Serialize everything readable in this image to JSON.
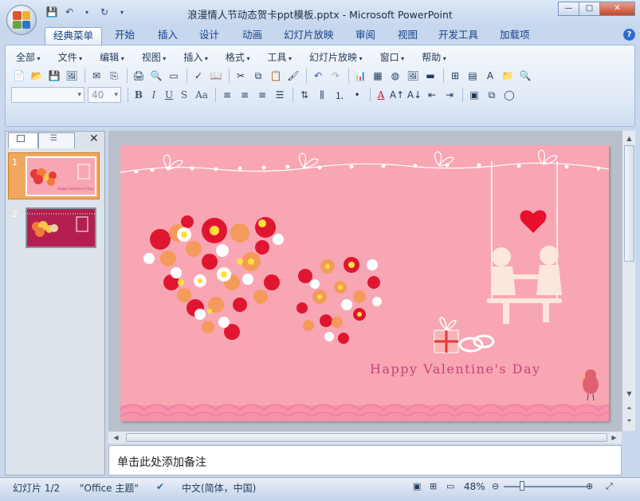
{
  "window": {
    "title": "浪漫情人节动态贺卡ppt模板.pptx - Microsoft PowerPoint",
    "minimize": "—",
    "restore": "□",
    "close": "✕"
  },
  "tabs": [
    "经典菜单",
    "开始",
    "插入",
    "设计",
    "动画",
    "幻灯片放映",
    "审阅",
    "视图",
    "开发工具",
    "加载项"
  ],
  "active_tab": "经典菜单",
  "menus": [
    "全部",
    "文件",
    "编辑",
    "视图",
    "插入",
    "格式",
    "工具",
    "幻灯片放映",
    "窗口",
    "帮助"
  ],
  "format": {
    "font_name": "",
    "font_size": "40",
    "bold": "B",
    "italic": "I",
    "underline": "U",
    "shadow": "S",
    "case": "Aa",
    "font_color": "A"
  },
  "slides": {
    "numbers": [
      "1",
      "2"
    ],
    "close": "✕"
  },
  "slide": {
    "text": "Happy Valentine's Day"
  },
  "notes": {
    "placeholder": "单击此处添加备注"
  },
  "status": {
    "slide_index": "幻灯片 1/2",
    "theme": "\"Office 主题\"",
    "language": "中文(简体，中国)",
    "zoom": "48%"
  },
  "colors": {
    "slide_bg": "#f8a6b4",
    "ribbon_text": "#15428b",
    "accent_red": "#e01631"
  },
  "icons": [
    "office-logo-icon",
    "save-icon",
    "undo-icon",
    "redo-icon",
    "new-icon",
    "open-icon",
    "print-icon",
    "cut-icon",
    "copy-icon",
    "paste-icon",
    "chart-icon",
    "table-icon",
    "zoom-icon",
    "heart-icon",
    "bird-icon",
    "gift-icon",
    "rings-icon"
  ]
}
